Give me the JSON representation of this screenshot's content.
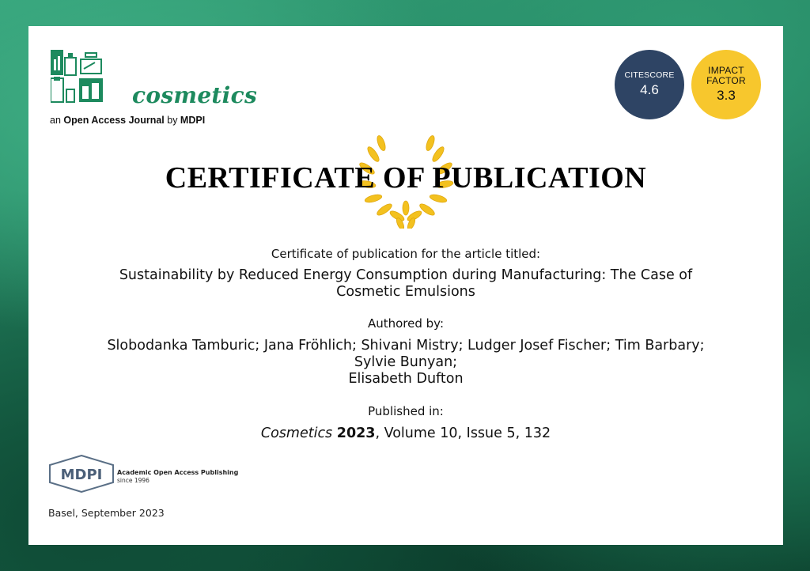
{
  "journal": {
    "name": "cosmetics",
    "tagline_prefix": "an ",
    "tagline_bold": "Open Access Journal",
    "tagline_mid": " by ",
    "tagline_publisher": "MDPI",
    "brand_color": "#1d8a5e"
  },
  "metrics": {
    "citescore_label": "CITESCORE",
    "citescore_value": "4.6",
    "impact_label_line1": "IMPACT",
    "impact_label_line2": "FACTOR",
    "impact_value": "3.3",
    "citescore_color": "#2e4464",
    "impact_color": "#f7c72d"
  },
  "certificate": {
    "title": "CERTIFICATE OF PUBLICATION",
    "intro": "Certificate of publication for the article titled:",
    "article_title_line1": "Sustainability by Reduced Energy Consumption during Manufacturing: The Case of",
    "article_title_line2": "Cosmetic Emulsions",
    "authored_label": "Authored by:",
    "authors_line1": "Slobodanka Tamburic; Jana Fröhlich; Shivani Mistry; Ludger Josef Fischer; Tim Barbary;",
    "authors_line2": "Sylvie Bunyan;",
    "authors_line3": "Elisabeth Dufton",
    "published_label": "Published in:",
    "journal_italic": "Cosmetics",
    "year": "2023",
    "citation_rest": ", Volume 10, Issue 5, 132"
  },
  "publisher": {
    "logo_text": "MDPI",
    "tagline": "Academic Open Access Publishing",
    "since": "since 1996"
  },
  "footer": {
    "place_date": "Basel, September 2023"
  }
}
